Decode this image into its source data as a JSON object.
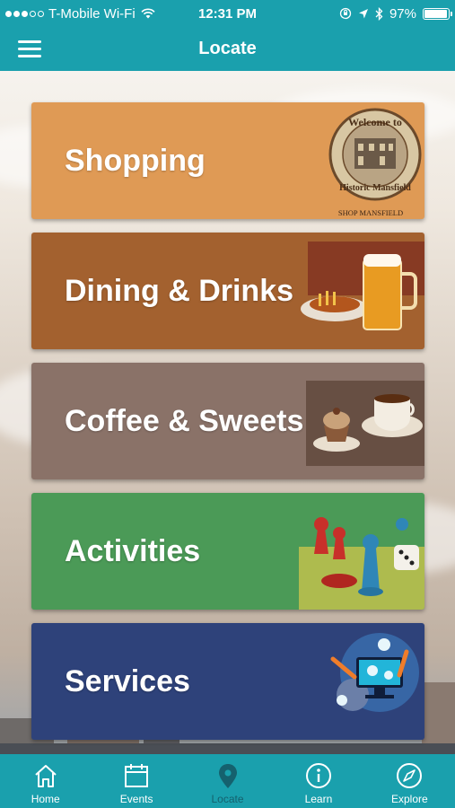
{
  "status_bar": {
    "carrier": "T-Mobile Wi-Fi",
    "time": "12:31 PM",
    "battery": "97%",
    "battery_level": 0.97,
    "signal_bars_filled": 3,
    "signal_bars_total": 5
  },
  "nav": {
    "title": "Locate",
    "menu_icon": "hamburger-menu-icon"
  },
  "categories": [
    {
      "label": "Shopping",
      "color": "#df9a55",
      "icon": "welcome-historic-mansfield-badge",
      "badge_text_top": "Welcome to",
      "badge_text_bottom": "Historic Mansfield",
      "badge_caption": "SHOP MANSFIELD"
    },
    {
      "label": "Dining & Drinks",
      "color": "#a3612f",
      "icon": "beer-and-food-image"
    },
    {
      "label": "Coffee & Sweets",
      "color": "#8a7268",
      "icon": "coffee-and-cupcake-image"
    },
    {
      "label": "Activities",
      "color": "#4b9a57",
      "icon": "board-game-pieces-image"
    },
    {
      "label": "Services",
      "color": "#2e427a",
      "icon": "computer-gears-tools-image"
    }
  ],
  "tabs": [
    {
      "label": "Home",
      "icon": "home-icon",
      "active": false
    },
    {
      "label": "Events",
      "icon": "calendar-icon",
      "active": false
    },
    {
      "label": "Locate",
      "icon": "map-pin-icon",
      "active": true
    },
    {
      "label": "Learn",
      "icon": "info-icon",
      "active": false
    },
    {
      "label": "Explore",
      "icon": "compass-icon",
      "active": false
    }
  ],
  "colors": {
    "bar": "#1aa0ad",
    "active_tab": "#15616e"
  }
}
